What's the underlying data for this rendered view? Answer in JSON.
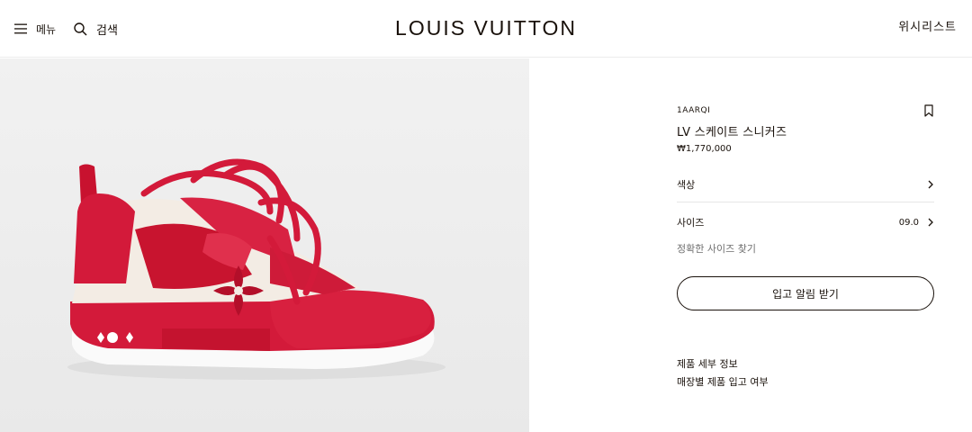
{
  "header": {
    "menu_label": "메뉴",
    "search_label": "검색",
    "logo": "LOUIS VUITTON",
    "wishlist_label": "위시리스트"
  },
  "product": {
    "sku": "1AARQI",
    "name": "LV 스케이트 스니커즈",
    "price": "₩1,770,000",
    "image_alt": "LV 스케이트 스니커즈",
    "color_label": "색상",
    "size_label": "사이즈",
    "size_value": "09.0",
    "size_guide_label": "정확한 사이즈 찾기",
    "notify_button_label": "입고 알림 받기",
    "details_link_label": "제품 세부 정보",
    "store_availability_label": "매장별 제품 입고 여부"
  },
  "colors": {
    "brand_text": "#19110b",
    "shoe_red": "#d31a3a",
    "shoe_cream": "#f3ece4",
    "image_bg": "#efefef"
  },
  "icons": {
    "menu": "hamburger-icon",
    "search": "search-icon",
    "bookmark": "bookmark-icon",
    "chevron": "chevron-right-icon"
  }
}
